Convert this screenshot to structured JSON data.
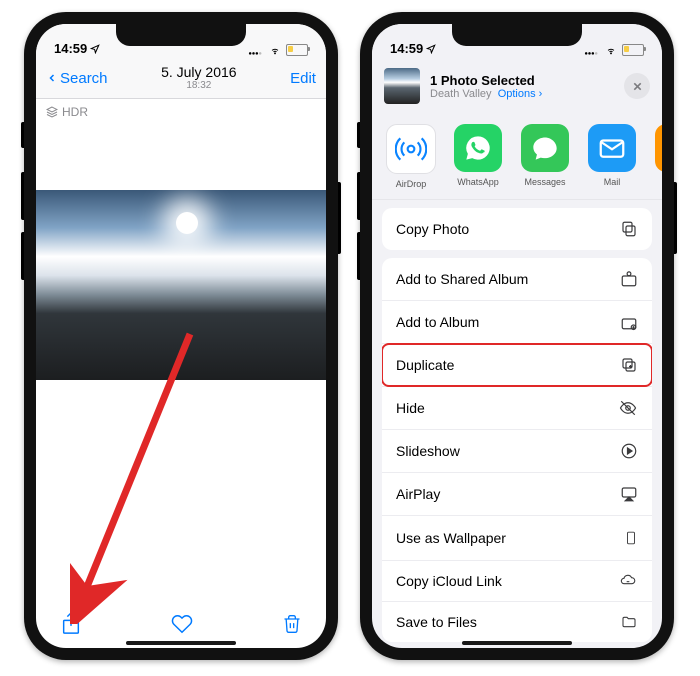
{
  "status": {
    "time": "14:59",
    "signal": "•••",
    "wifi": "wifi",
    "battery_fill_color": "#f7ce46"
  },
  "left": {
    "back_label": "Search",
    "title": "5. July 2016",
    "subtitle": "18:32",
    "edit_label": "Edit",
    "hdr_label": "HDR"
  },
  "right": {
    "title": "1 Photo Selected",
    "location": "Death Valley",
    "options_label": "Options",
    "apps": [
      {
        "name": "AirDrop"
      },
      {
        "name": "WhatsApp"
      },
      {
        "name": "Messages"
      },
      {
        "name": "Mail"
      }
    ],
    "actions": {
      "copy_photo": "Copy Photo",
      "add_shared": "Add to Shared Album",
      "add_album": "Add to Album",
      "duplicate": "Duplicate",
      "hide": "Hide",
      "slideshow": "Slideshow",
      "airplay": "AirPlay",
      "wallpaper": "Use as Wallpaper",
      "icloud_link": "Copy iCloud Link",
      "save_files": "Save to Files"
    }
  }
}
